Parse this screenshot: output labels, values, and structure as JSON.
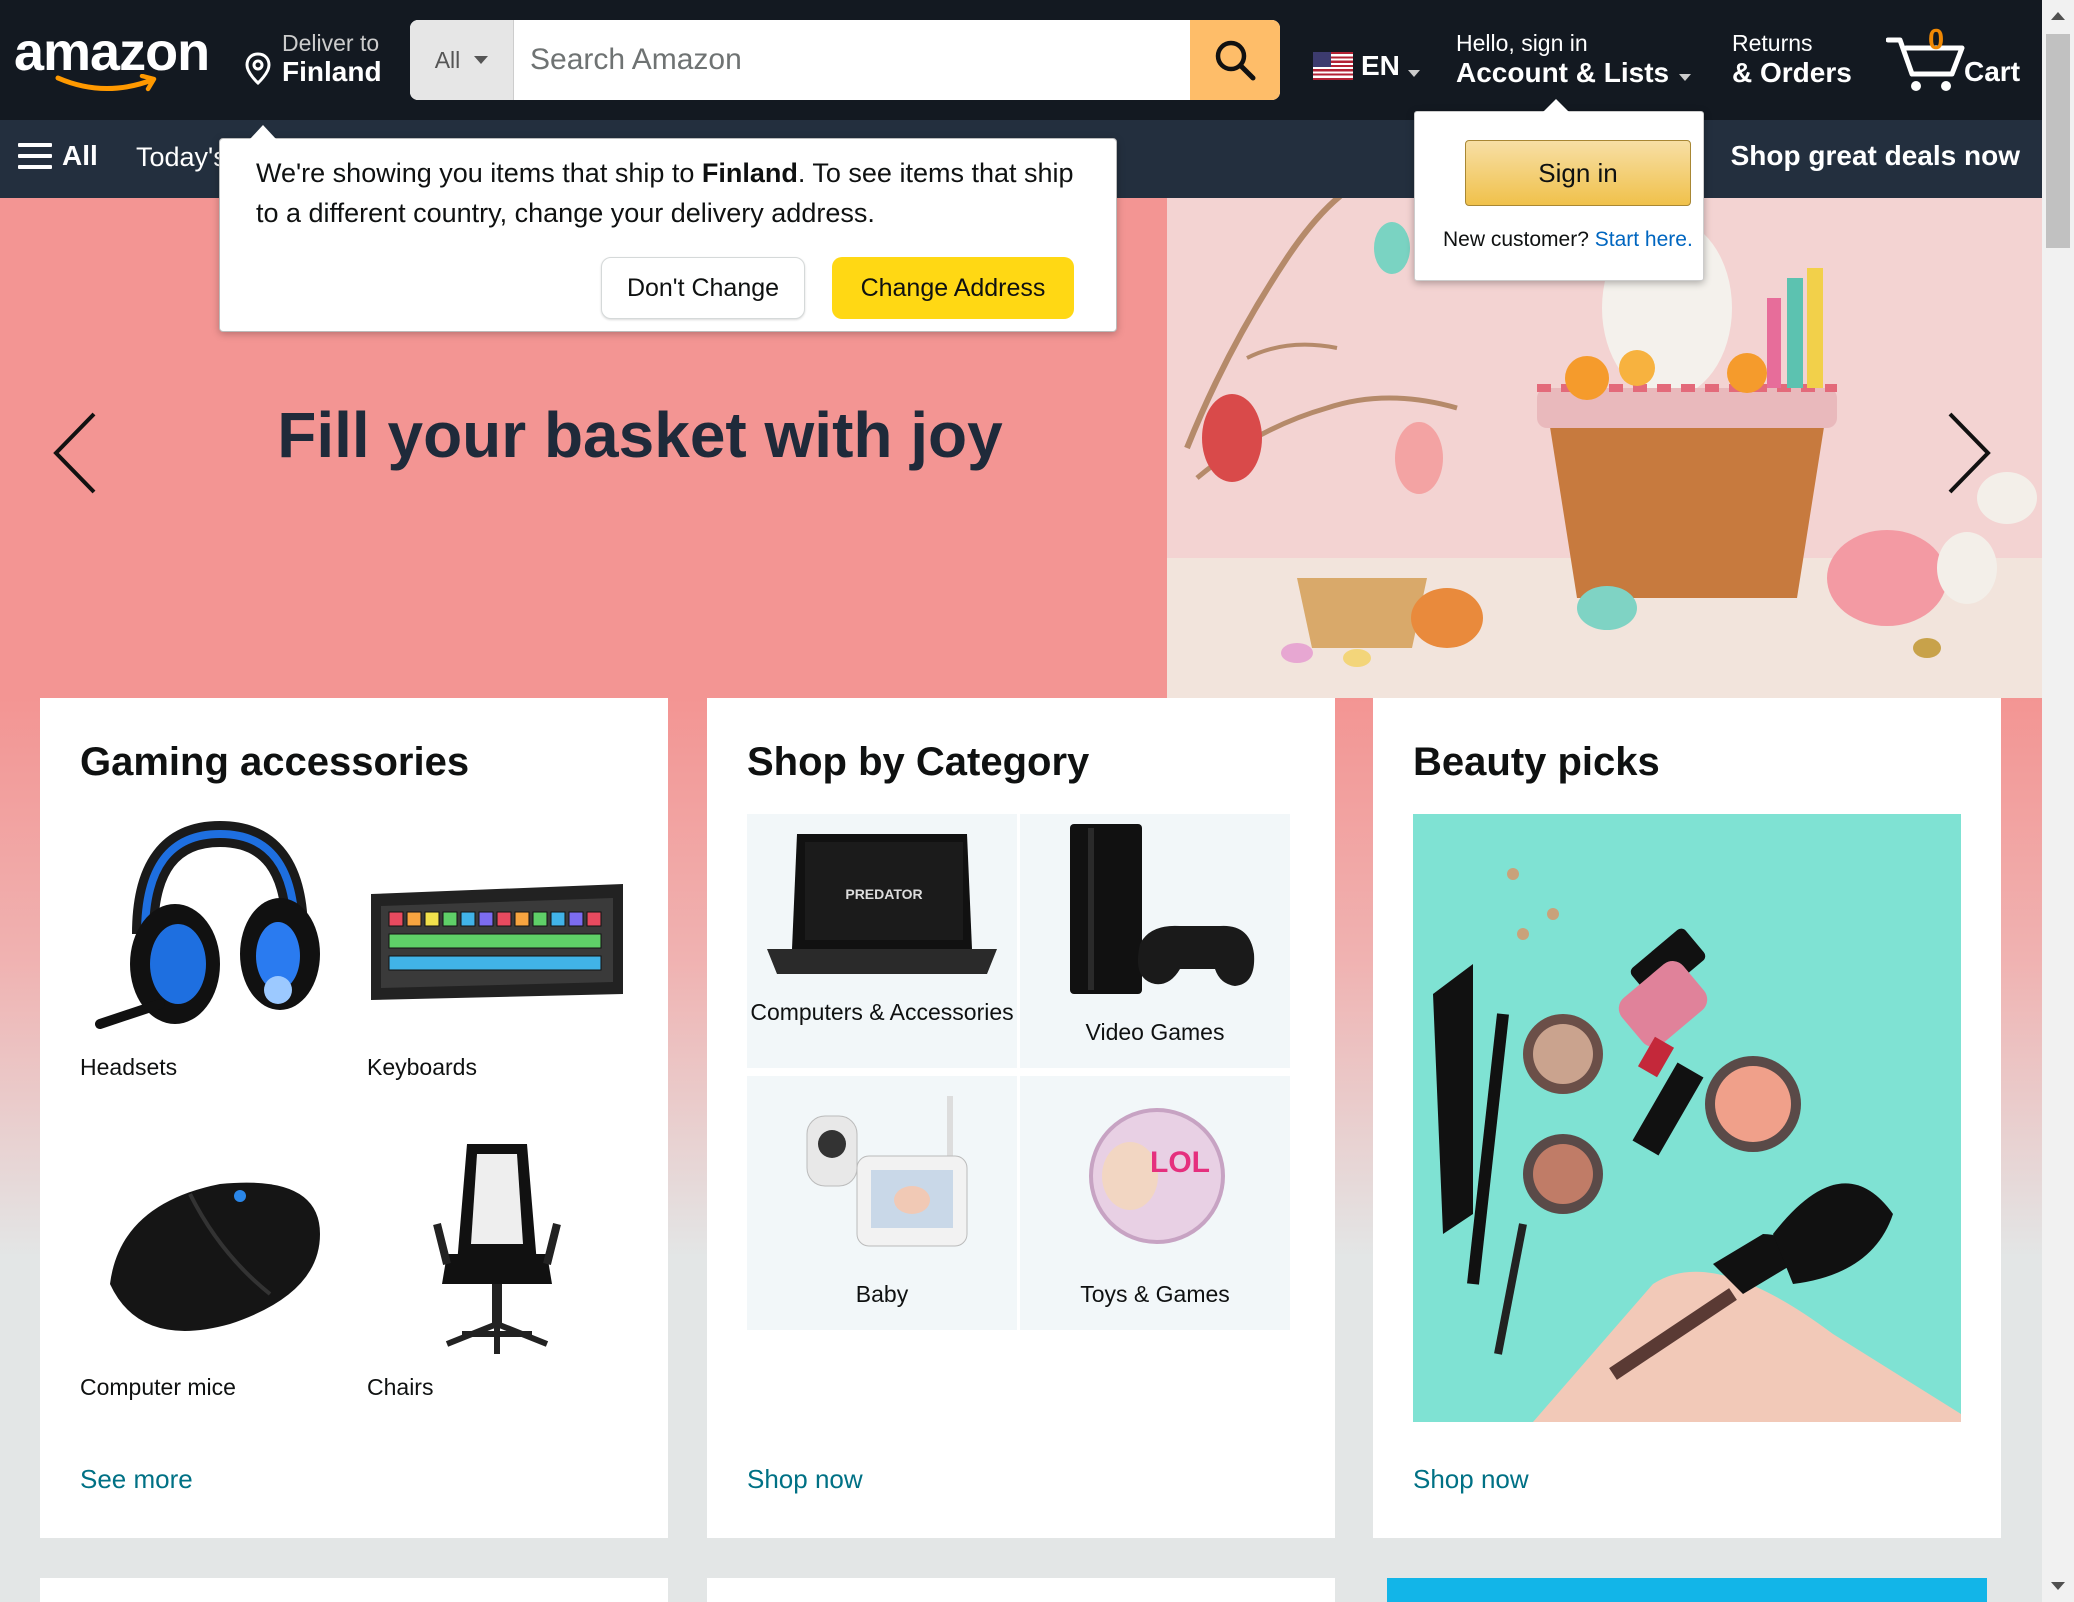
{
  "header": {
    "logo_text": "amazon",
    "deliver_label": "Deliver to",
    "deliver_country": "Finland",
    "search_category": "All",
    "search_placeholder": "Search Amazon",
    "language": "EN",
    "account_greeting": "Hello, sign in",
    "account_label": "Account & Lists",
    "returns_label": "Returns",
    "orders_label": "& Orders",
    "cart_count": "0",
    "cart_label": "Cart"
  },
  "nav": {
    "all_label": "All",
    "today_label": "Today's",
    "deals_label": "Shop great deals now"
  },
  "hero": {
    "headline": "Fill your basket with joy"
  },
  "location_popover": {
    "message_prefix": "We're showing you items that ship to ",
    "message_country": "Finland",
    "message_suffix": ". To see items that ship to a different country, change your delivery address.",
    "dont_change_label": "Don't Change",
    "change_address_label": "Change Address"
  },
  "signin_popover": {
    "signin_label": "Sign in",
    "new_customer_label": "New customer?",
    "start_here_label": "Start here."
  },
  "cards": [
    {
      "title": "Gaming accessories",
      "items": [
        "Headsets",
        "Keyboards",
        "Computer mice",
        "Chairs"
      ],
      "link": "See more"
    },
    {
      "title": "Shop by Category",
      "items": [
        "Computers & Accessories",
        "Video Games",
        "Baby",
        "Toys & Games"
      ],
      "link": "Shop now"
    },
    {
      "title": "Beauty picks",
      "link": "Shop now"
    }
  ],
  "colors": {
    "header_bg": "#131921",
    "nav_bg": "#232f3e",
    "search_button": "#febd69",
    "hero_bg": "#f39593",
    "change_address_button": "#ffd814",
    "link": "#007185",
    "cart_count": "#f08804"
  }
}
